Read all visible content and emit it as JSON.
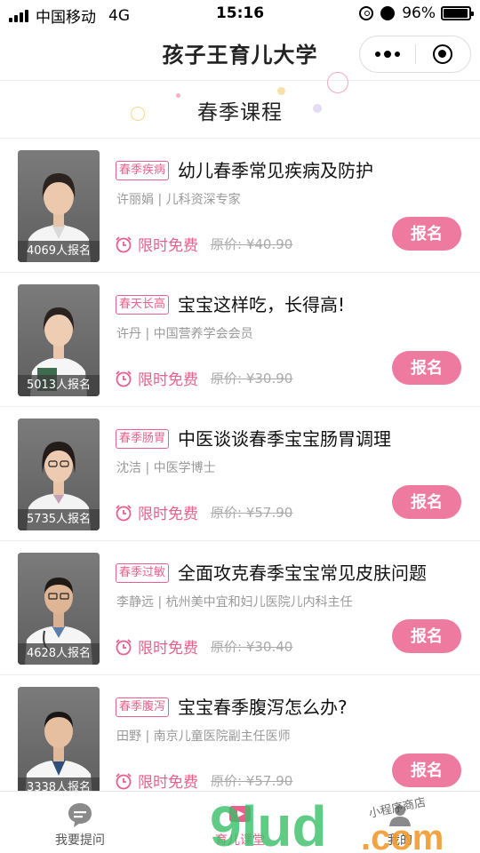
{
  "status_bar": {
    "carrier": "中国移动",
    "network": "4G",
    "time": "15:16",
    "battery": "96%",
    "battery_level": 0.96
  },
  "nav": {
    "title": "孩子王育儿大学"
  },
  "banner": {
    "title": "春季课程"
  },
  "courses": [
    {
      "tag": "春季疾病",
      "title": "幼儿春季常见疾病及防护",
      "teacher": "许丽娟 | 儿科资深专家",
      "enrolled": "4069人报名",
      "free_label": "限时免费",
      "original_price": "原价: ¥40.90",
      "signup_label": "报名"
    },
    {
      "tag": "春天长高",
      "title": "宝宝这样吃，长得高!",
      "teacher": "许丹 | 中国营养学会会员",
      "enrolled": "5013人报名",
      "free_label": "限时免费",
      "original_price": "原价: ¥30.90",
      "signup_label": "报名"
    },
    {
      "tag": "春季肠胃",
      "title": "中医谈谈春季宝宝肠胃调理",
      "teacher": "沈洁 | 中医学博士",
      "enrolled": "5735人报名",
      "free_label": "限时免费",
      "original_price": "原价: ¥57.90",
      "signup_label": "报名"
    },
    {
      "tag": "春季过敏",
      "title": "全面攻克春季宝宝常见皮肤问题",
      "teacher": "李静远 | 杭州美中宜和妇儿医院儿内科主任",
      "enrolled": "4628人报名",
      "free_label": "限时免费",
      "original_price": "原价: ¥30.40",
      "signup_label": "报名"
    },
    {
      "tag": "春季腹泻",
      "title": "宝宝春季腹泻怎么办?",
      "teacher": "田野 | 南京儿童医院副主任医师",
      "enrolled": "3338人报名",
      "free_label": "限时免费",
      "original_price": "原价: ¥57.90",
      "signup_label": "报名"
    }
  ],
  "tabs": [
    {
      "label": "我要提问",
      "icon": "question-bubble-icon"
    },
    {
      "label": "育儿课堂",
      "icon": "classroom-icon",
      "active": true
    },
    {
      "label": "我的",
      "icon": "profile-icon"
    }
  ],
  "watermark": {
    "logo": "9lud",
    "tagline": "小程序商店",
    "suffix": ".com"
  },
  "colors": {
    "accent": "#e8608b",
    "button": "#ef7aa0"
  }
}
